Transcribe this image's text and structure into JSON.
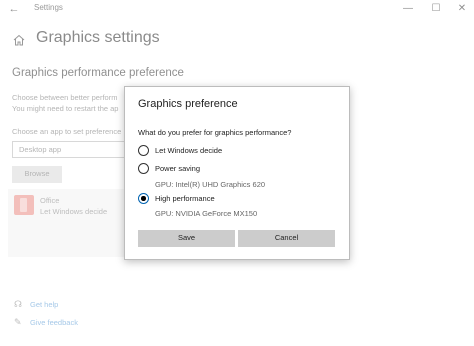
{
  "window": {
    "title": "Settings",
    "back_glyph": "←",
    "min_glyph": "—",
    "max_glyph": "☐",
    "close_glyph": "✕"
  },
  "page": {
    "title": "Graphics settings",
    "section_title": "Graphics performance preference",
    "desc_line1": "Choose between better perform",
    "desc_line2": "You might need to restart the ap",
    "choose_label": "Choose an app to set preference",
    "dropdown_value": "Desktop app",
    "browse_label": "Browse"
  },
  "app_item": {
    "name": "Office",
    "setting": "Let Windows decide"
  },
  "footer": {
    "help": "Get help",
    "feedback": "Give feedback"
  },
  "dialog": {
    "title": "Graphics preference",
    "question": "What do you prefer for graphics performance?",
    "options": [
      {
        "label": "Let Windows decide",
        "checked": false
      },
      {
        "label": "Power saving",
        "checked": false,
        "gpu": "GPU: Intel(R) UHD Graphics 620"
      },
      {
        "label": "High performance",
        "checked": true,
        "gpu": "GPU: NVIDIA GeForce MX150"
      }
    ],
    "save_label": "Save",
    "cancel_label": "Cancel"
  },
  "colors": {
    "link": "#5b9bd5",
    "radio_accent": "#0063b1",
    "app_icon": "#e98b83"
  }
}
